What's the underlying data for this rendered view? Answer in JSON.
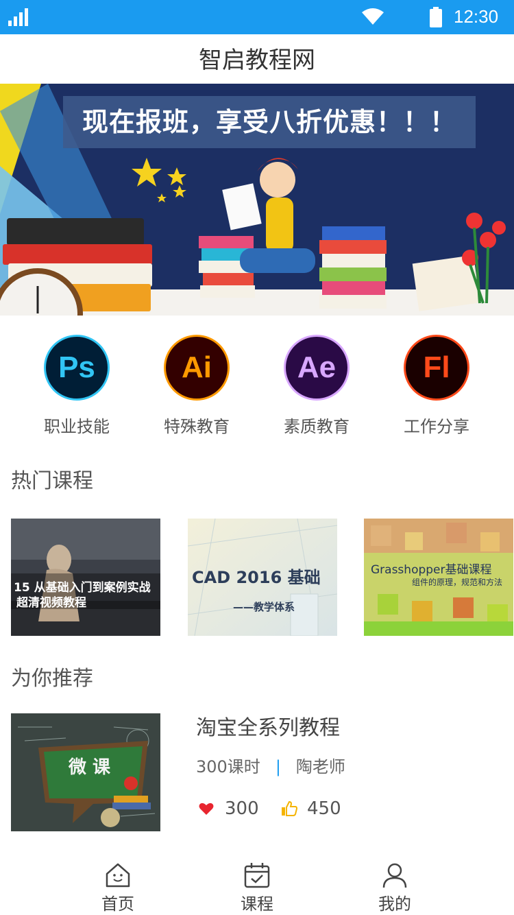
{
  "status": {
    "time": "12:30"
  },
  "header": {
    "title": "智启教程网"
  },
  "banner": {
    "headline": "现在报班，享受八折优惠！！！"
  },
  "categories": [
    {
      "icon_text": "Ps",
      "label": "职业技能",
      "fg": "#31c5f4",
      "bg": "#001e36"
    },
    {
      "icon_text": "Ai",
      "label": "特殊教育",
      "fg": "#ff9a00",
      "bg": "#330000"
    },
    {
      "icon_text": "Ae",
      "label": "素质教育",
      "fg": "#d8a7ff",
      "bg": "#2a0a46"
    },
    {
      "icon_text": "Fl",
      "label": "工作分享",
      "fg": "#ff4a1a",
      "bg": "#1a0000"
    }
  ],
  "hot": {
    "title": "热门课程",
    "items": [
      {
        "line1": "15 从基础入门到案例实战",
        "line2": "超清视频教程"
      },
      {
        "line1": "CAD 2016 基础",
        "line2": "——教学体系"
      },
      {
        "line1": "Grasshopper基础课程",
        "line2": "组件的原理，规范和方法"
      }
    ]
  },
  "recommend": {
    "title": "为你推荐",
    "item": {
      "thumb_text": "微 课",
      "title": "淘宝全系列教程",
      "hours": "300课时",
      "teacher": "陶老师",
      "likes": "300",
      "thumbs": "450"
    }
  },
  "tabs": [
    {
      "label": "首页",
      "icon": "home-icon"
    },
    {
      "label": "课程",
      "icon": "calendar-check-icon"
    },
    {
      "label": "我的",
      "icon": "user-icon"
    }
  ],
  "colors": {
    "accent": "#1a9bf0",
    "heart": "#e8252f",
    "thumb": "#f5b400"
  }
}
